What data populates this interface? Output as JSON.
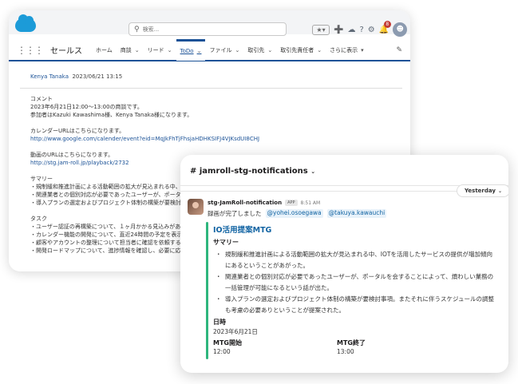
{
  "salesforce": {
    "search_placeholder": "検索...",
    "app_name": "セールス",
    "notification_count": "8",
    "nav_items": [
      {
        "label": "ホーム"
      },
      {
        "label": "商談"
      },
      {
        "label": "リード"
      },
      {
        "label": "ToDo"
      },
      {
        "label": "ファイル"
      },
      {
        "label": "取引先"
      },
      {
        "label": "取引先責任者"
      },
      {
        "label": "さらに表示"
      }
    ],
    "author": "Kenya Tanaka",
    "datetime": "2023/06/21  13:15",
    "lines": [
      "コメント",
      "2023年6月21日12:00〜13:00の商談です。",
      "参加者はKazuki Kawashima様、Kenya Tanaka様になります。",
      "",
      "カレンダーURLはこちらになります。",
      "http://www.google.com/calender/event?eid=MqJkFhTjFhsjaHDHKSIFJ4VJKsdUI8CHJ",
      "",
      "動画のURLはこちらになります。",
      "http://stg.jam-roll.jp/playback/2732",
      "",
      "サマリー",
      "・規制緩和推進計画による活動範囲の拡大が見込まれる中、IO",
      "・関連業者との個別対応が必要であったユーザーが、ポータル",
      "・導入プランの選定およびプロジェクト体制の構築が要検討事",
      "",
      "タスク",
      "・ユーザー認証の再構築について、１ヶ月かかる見込みがある",
      "・カレンダー機能の開発について、直近24時間の予定を表示す",
      "・顧客やアカウントの整理について担当者に確認を依頼する。",
      "・開発ロードマップについて、進捗情報を確認し、必要に応じ"
    ]
  },
  "slack": {
    "channel": "# jamroll-stg-notifications",
    "date_pill": "Yesterday",
    "bot_name": "stg-JamRoll-notification",
    "app_badge": "APP",
    "time": "8:51 AM",
    "message": "録画が完了しました",
    "mentions": [
      "@yohei.osoegawa",
      "@takuya.kawauchi"
    ],
    "attachment": {
      "title": "IO活用提案MTG",
      "summary_label": "サマリー",
      "bullets": [
        "規制緩和推進計画による活動範囲の拡大が見込まれる中、IOTを活用したサービスの提供が増加傾向にあるということがあがった。",
        "関連業者との個別対応が必要であったユーザーが、ポータルを会することによって、煩わしい業務の一括管理が可能になるという話が出た。",
        "導入プランの選定およびプロジェクト体制の構築が要検討事項。またそれに伴うスケジュールの調整も考慮の必要ありということが提案された。"
      ],
      "date_label": "日時",
      "date_value": "2023年6月21日",
      "start_label": "MTG開始",
      "start_value": "12:00",
      "end_label": "MTG終了",
      "end_value": "13:00"
    }
  }
}
